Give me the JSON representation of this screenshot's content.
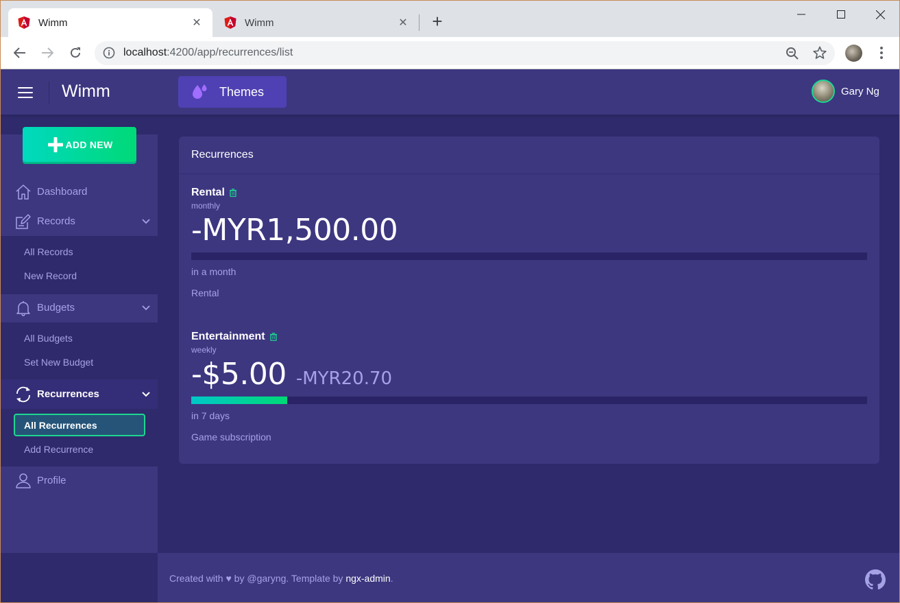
{
  "browser": {
    "tabs": [
      {
        "title": "Wimm",
        "close": "✕",
        "active": true
      },
      {
        "title": "Wimm",
        "close": "✕",
        "active": false
      }
    ],
    "new_tab": "+",
    "url_host": "localhost",
    "url_path": ":4200/app/recurrences/list"
  },
  "header": {
    "logo": "Wimm",
    "themes_label": "Themes",
    "user_name": "Gary Ng"
  },
  "sidebar": {
    "add_new_label": "ADD NEW",
    "items": [
      {
        "label": "Dashboard",
        "icon": "home-icon"
      },
      {
        "label": "Records",
        "icon": "edit-icon",
        "expanded": true,
        "children": [
          {
            "label": "All Records"
          },
          {
            "label": "New Record"
          }
        ]
      },
      {
        "label": "Budgets",
        "icon": "bell-icon",
        "expanded": true,
        "children": [
          {
            "label": "All Budgets"
          },
          {
            "label": "Set New Budget"
          }
        ]
      },
      {
        "label": "Recurrences",
        "icon": "sync-icon",
        "expanded": true,
        "active": true,
        "children": [
          {
            "label": "All Recurrences",
            "selected": true
          },
          {
            "label": "Add Recurrence"
          }
        ]
      },
      {
        "label": "Profile",
        "icon": "person-icon"
      }
    ]
  },
  "main": {
    "card_title": "Recurrences",
    "recurrences": [
      {
        "title": "Rental",
        "frequency": "monthly",
        "amount": "-MYR1,500.00",
        "converted": "",
        "progress": 0.0,
        "due": "in a month",
        "description": "Rental"
      },
      {
        "title": "Entertainment",
        "frequency": "weekly",
        "amount": "-$5.00",
        "converted": "-MYR20.70",
        "progress": 0.142,
        "due": "in 7 days",
        "description": "Game subscription"
      }
    ]
  },
  "footer": {
    "prefix": "Created with ",
    "heart": "♥",
    "by": " by ",
    "author": "@garyng",
    "mid": ". Template by ",
    "template_link": "ngx-admin",
    "suffix": "."
  },
  "colors": {
    "accent": "#1cd891",
    "header_bg": "#3d3780",
    "page_bg": "#2f2a6b",
    "muted_text": "#a6a2e6"
  }
}
